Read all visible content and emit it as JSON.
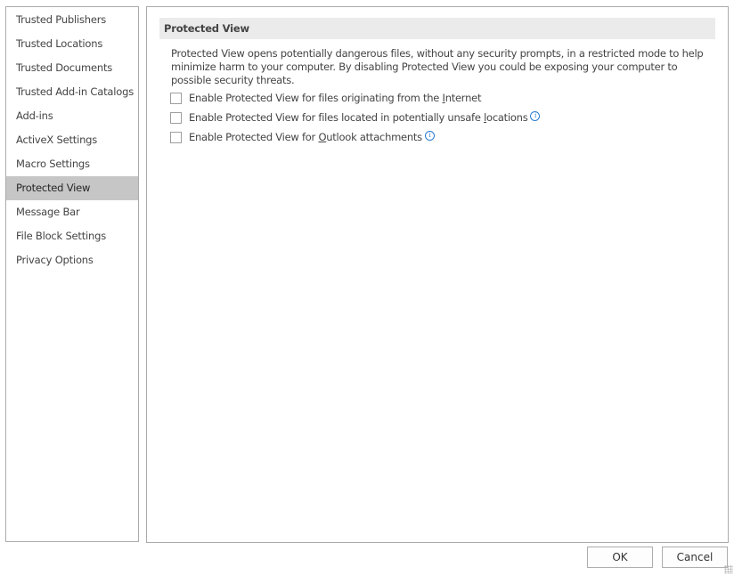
{
  "sidebar": {
    "items": [
      {
        "label": "Trusted Publishers",
        "selected": false
      },
      {
        "label": "Trusted Locations",
        "selected": false
      },
      {
        "label": "Trusted Documents",
        "selected": false
      },
      {
        "label": "Trusted Add-in Catalogs",
        "selected": false
      },
      {
        "label": "Add-ins",
        "selected": false
      },
      {
        "label": "ActiveX Settings",
        "selected": false
      },
      {
        "label": "Macro Settings",
        "selected": false
      },
      {
        "label": "Protected View",
        "selected": true
      },
      {
        "label": "Message Bar",
        "selected": false
      },
      {
        "label": "File Block Settings",
        "selected": false
      },
      {
        "label": "Privacy Options",
        "selected": false
      }
    ]
  },
  "main": {
    "section_title": "Protected View",
    "description": "Protected View opens potentially dangerous files, without any security prompts, in a restricted mode to help minimize harm to your computer. By disabling Protected View you could be exposing your computer to possible security threats.",
    "options": [
      {
        "pre": "Enable Protected View for files originating from the ",
        "accel": "I",
        "post": "nternet",
        "checked": false,
        "info_icon": false
      },
      {
        "pre": "Enable Protected View for files located in potentially unsafe ",
        "accel": "l",
        "post": "ocations",
        "checked": false,
        "info_icon": true
      },
      {
        "pre": "Enable Protected View for ",
        "accel": "O",
        "post": "utlook attachments",
        "checked": false,
        "info_icon": true
      }
    ],
    "info_icon_glyph": "i"
  },
  "footer": {
    "ok_label": "OK",
    "cancel_label": "Cancel"
  }
}
